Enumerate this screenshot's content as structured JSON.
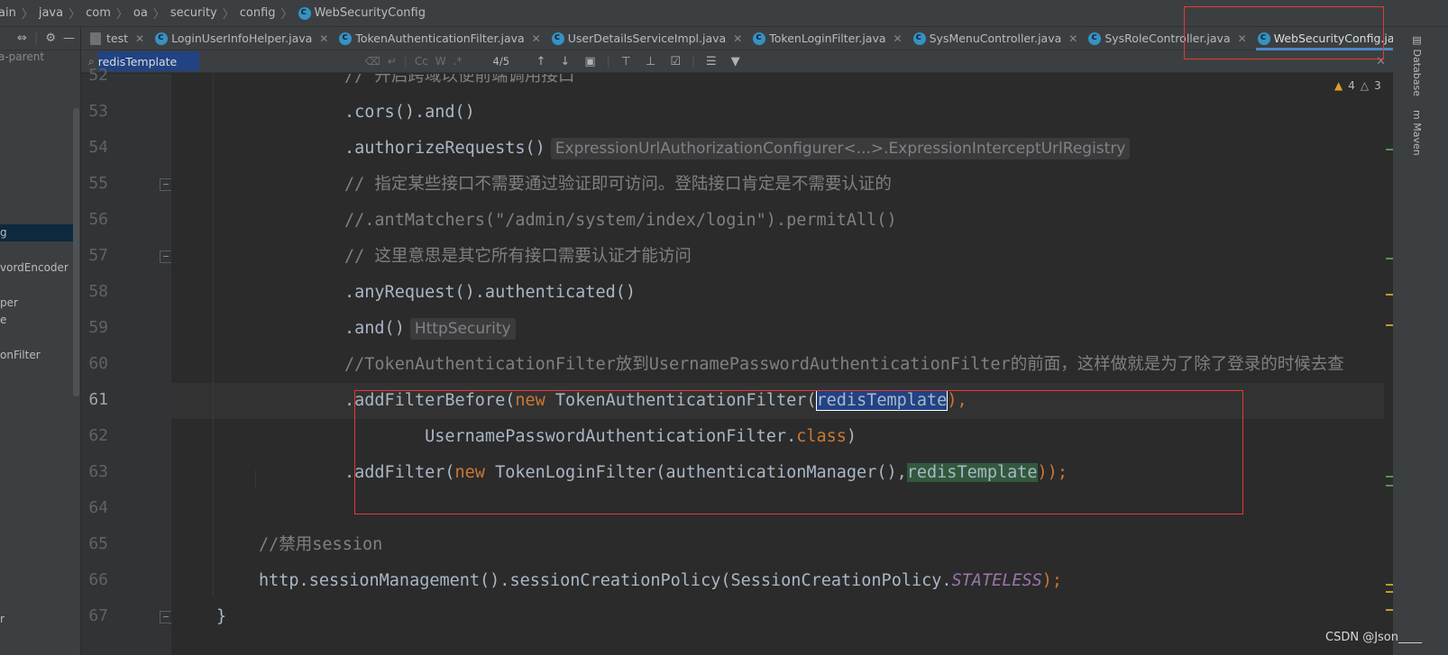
{
  "breadcrumb": {
    "items": [
      "ain",
      "java",
      "com",
      "oa",
      "security",
      "config"
    ],
    "current": "WebSecurityConfig"
  },
  "project_panel": {
    "root_label": "a-parent",
    "tree": [
      "g",
      "vordEncoder",
      "per",
      "e",
      "onFilter",
      "r"
    ]
  },
  "tabs": [
    {
      "label": "test",
      "active": false
    },
    {
      "label": "LoginUserInfoHelper.java",
      "active": false
    },
    {
      "label": "TokenAuthenticationFilter.java",
      "active": false
    },
    {
      "label": "UserDetailsServiceImpl.java",
      "active": false
    },
    {
      "label": "TokenLoginFilter.java",
      "active": false
    },
    {
      "label": "SysMenuController.java",
      "active": false
    },
    {
      "label": "SysRoleController.java",
      "active": false
    },
    {
      "label": "WebSecurityConfig.java",
      "active": true
    }
  ],
  "search": {
    "query": "redisTemplate",
    "match_count": "4/5",
    "case_label": "Cc",
    "word_label": "W",
    "regex_label": ".*"
  },
  "inspection": {
    "warnings": "4",
    "weak_warnings": "3"
  },
  "right_tools": [
    "Database",
    "Maven"
  ],
  "editor": {
    "current_line": 61,
    "lines": [
      {
        "n": "52",
        "text": "// 开启跨域以便前端调用接口"
      },
      {
        "n": "53",
        "text": ".cors().and()"
      },
      {
        "n": "54",
        "text": ".authorizeRequests()",
        "hint": "ExpressionUrlAuthorizationConfigurer<...>.ExpressionInterceptUrlRegistry"
      },
      {
        "n": "55",
        "text": "// 指定某些接口不需要通过验证即可访问。登陆接口肯定是不需要认证的"
      },
      {
        "n": "56",
        "text": "//.antMatchers(\"/admin/system/index/login\").permitAll()"
      },
      {
        "n": "57",
        "text": "// 这里意思是其它所有接口需要认证才能访问"
      },
      {
        "n": "58",
        "text": ".anyRequest().authenticated()"
      },
      {
        "n": "59",
        "text": ".and()",
        "hint": "HttpSecurity"
      },
      {
        "n": "60",
        "text": "//TokenAuthenticationFilter放到UsernamePasswordAuthenticationFilter的前面，这样做就是为了除了登录的时候去查"
      },
      {
        "n": "61",
        "pre": ".addFilterBefore(",
        "kw": "new",
        "mid": " TokenAuthenticationFilter(",
        "highlight": "redisTemplate",
        "post": "),"
      },
      {
        "n": "62",
        "pre": "        UsernamePasswordAuthenticationFilter.",
        "kw": "class",
        "post": ")"
      },
      {
        "n": "63",
        "pre": ".addFilter(",
        "kw": "new",
        "mid": " TokenLoginFilter(authenticationManager(),",
        "highlight": "redisTemplate",
        "post": "));"
      },
      {
        "n": "64",
        "text": ""
      },
      {
        "n": "65",
        "text": "//禁用session"
      },
      {
        "n": "66",
        "pre": "http.sessionManagement().sessionCreationPolicy(SessionCreationPolicy.",
        "static": "STATELESS",
        "post": ");"
      },
      {
        "n": "67",
        "text": "}"
      }
    ]
  },
  "watermark": "CSDN @Json____",
  "colors": {
    "background": "#2b2b2b",
    "keyword": "#cc7832",
    "comment": "#808080",
    "static_field": "#9876aa",
    "annotation_box": "#e53935",
    "active_tab_underline": "#4a88c7"
  }
}
